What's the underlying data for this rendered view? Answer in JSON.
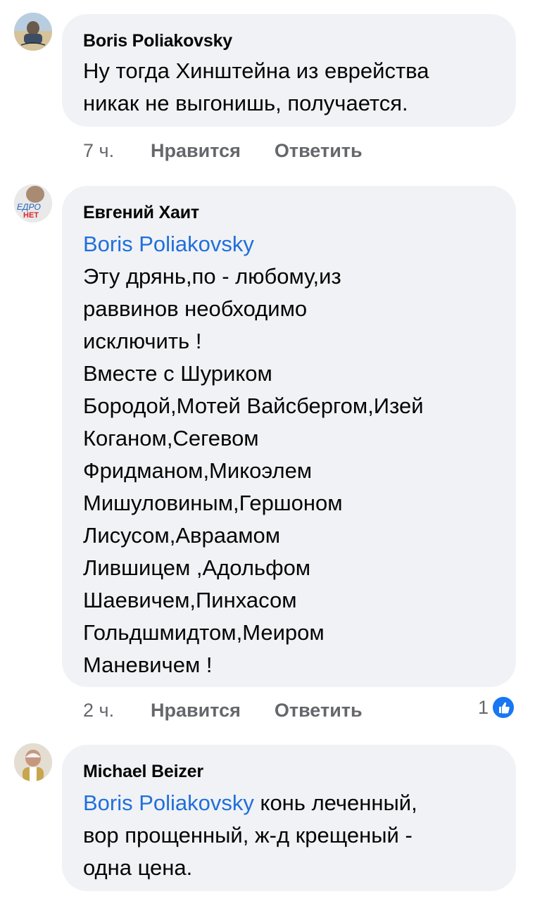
{
  "comments": [
    {
      "author": "Boris Poliakovsky",
      "mention": "",
      "text": "Ну тогда Хинштейна из еврейства\nникак не выгонишь, получается.",
      "time": "7 ч.",
      "like_label": "Нравится",
      "reply_label": "Ответить",
      "reactions": ""
    },
    {
      "author": "Евгений Хаит",
      "mention": "Boris Poliakovsky",
      "text": "Эту дрянь,по - любому,из\nраввинов необходимо\nисключить !\nВместе с Шуриком\nБородой,Мотей Вайсбергом,Изей\nКоганом,Сегевом\nФридманом,Микоэлем\nМишуловиным,Гершоном\nЛисусом,Авраамом\nЛившицем ,Адольфом\nШаевичем,Пинхасом\nГольдшмидтом,Меиром\nМаневичем !",
      "time": "2 ч.",
      "like_label": "Нравится",
      "reply_label": "Ответить",
      "reactions": "1",
      "avatar_badge_top": "ЕДРО",
      "avatar_badge_bottom": "НЕТ"
    },
    {
      "author": "Michael Beizer",
      "mention": "Boris Poliakovsky",
      "text_inline": " конь леченный,",
      "text": "вор прощенный, ж-д крещеный -\nодна цена."
    }
  ],
  "colors": {
    "bubble": "#f0f2f5",
    "mention": "#216fdb",
    "meta": "#65676b",
    "like": "#1877f2"
  },
  "icons": {
    "reaction": "thumbs-up-icon"
  }
}
